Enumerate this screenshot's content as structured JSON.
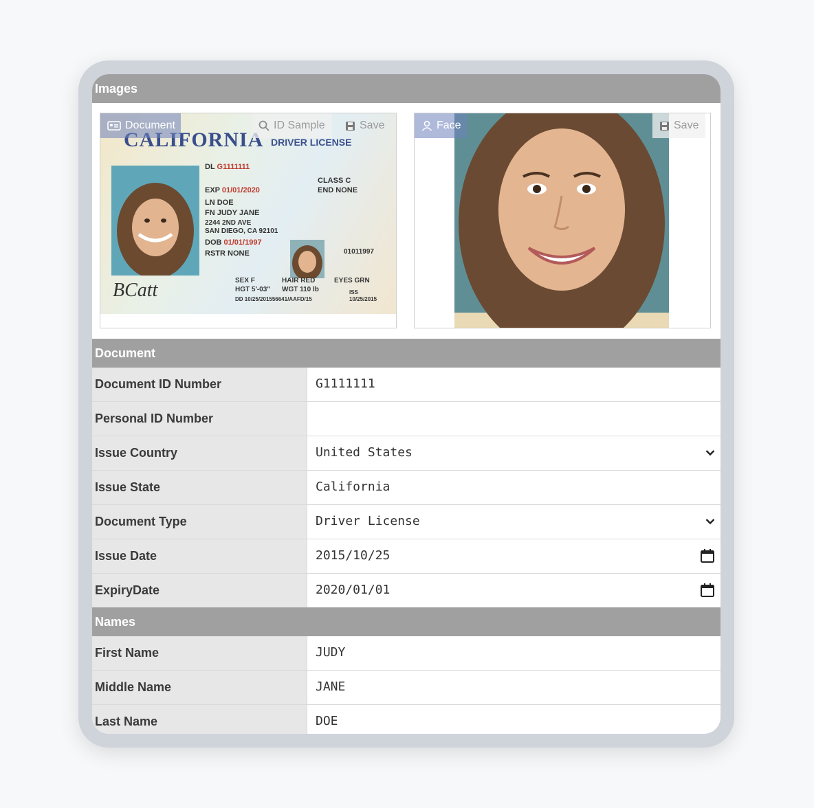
{
  "sections": {
    "images": "Images",
    "document": "Document",
    "names": "Names"
  },
  "images": {
    "document_tag": "Document",
    "id_sample": "ID Sample",
    "save": "Save",
    "face_tag": "Face",
    "face_save": "Save",
    "card": {
      "state": "CALIFORNIA",
      "type": "DRIVER LICENSE",
      "dl_label": "DL",
      "dl": "G1111111",
      "exp_label": "EXP",
      "exp": "01/01/2020",
      "ln_label": "LN",
      "ln": "DOE",
      "fn_label": "FN",
      "fn": "JUDY JANE",
      "addr1": "2244 2ND AVE",
      "addr2": "SAN DIEGO, CA 92101",
      "dob_label": "DOB",
      "dob": "01/01/1997",
      "rstr_label": "RSTR",
      "rstr": "NONE",
      "class_label": "CLASS",
      "class": "C",
      "end_label": "END",
      "end": "NONE",
      "num": "01011997",
      "sex_label": "SEX",
      "sex": "F",
      "hair_label": "HAIR",
      "hair": "RED",
      "eyes_label": "EYES",
      "eyes": "GRN",
      "hgt_label": "HGT",
      "hgt": "5'-03\"",
      "wgt_label": "WGT",
      "wgt": "110 lb",
      "dd_label": "DD",
      "dd": "10/25/201556641/AAFD/15",
      "iss_label": "ISS",
      "iss": "10/25/2015",
      "signature": "BCatt"
    }
  },
  "document_fields": [
    {
      "label": "Document ID Number",
      "value": "G1111111",
      "control": ""
    },
    {
      "label": "Personal ID Number",
      "value": "",
      "control": ""
    },
    {
      "label": "Issue Country",
      "value": "United States",
      "control": "select"
    },
    {
      "label": "Issue State",
      "value": "California",
      "control": ""
    },
    {
      "label": "Document Type",
      "value": "Driver License",
      "control": "select"
    },
    {
      "label": "Issue Date",
      "value": "2015/10/25",
      "control": "date"
    },
    {
      "label": "ExpiryDate",
      "value": "2020/01/01",
      "control": "date"
    }
  ],
  "name_fields": [
    {
      "label": "First Name",
      "value": "JUDY"
    },
    {
      "label": "Middle Name",
      "value": "JANE"
    },
    {
      "label": "Last Name",
      "value": "DOE"
    }
  ]
}
